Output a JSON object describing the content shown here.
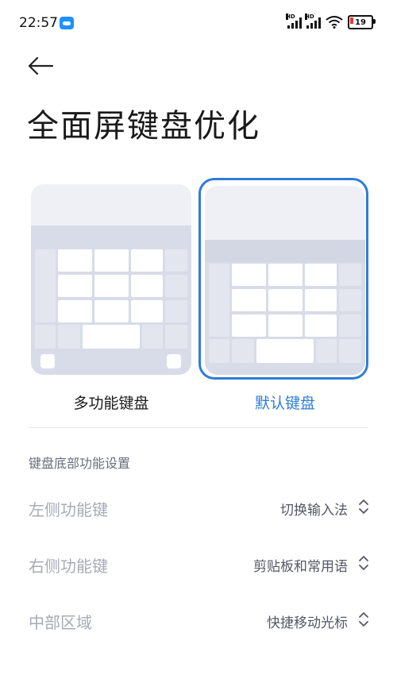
{
  "status": {
    "time": "22:57",
    "battery": "19",
    "net1": "HD",
    "net2": "HD"
  },
  "header": {
    "title": "全面屏键盘优化"
  },
  "options": [
    {
      "label": "多功能键盘",
      "selected": false
    },
    {
      "label": "默认键盘",
      "selected": true
    }
  ],
  "section_title": "键盘底部功能设置",
  "settings": [
    {
      "label": "左侧功能键",
      "value": "切换输入法"
    },
    {
      "label": "右侧功能键",
      "value": "剪贴板和常用语"
    },
    {
      "label": "中部区域",
      "value": "快捷移动光标"
    }
  ],
  "colors": {
    "accent": "#2f7cd8",
    "muted": "#a8abb4",
    "card_bg": "#eef0f6"
  },
  "icons": [
    "cloud-icon",
    "signal-icon",
    "wifi-icon",
    "battery-icon",
    "back-arrow-icon",
    "chevron-updown-icon"
  ]
}
